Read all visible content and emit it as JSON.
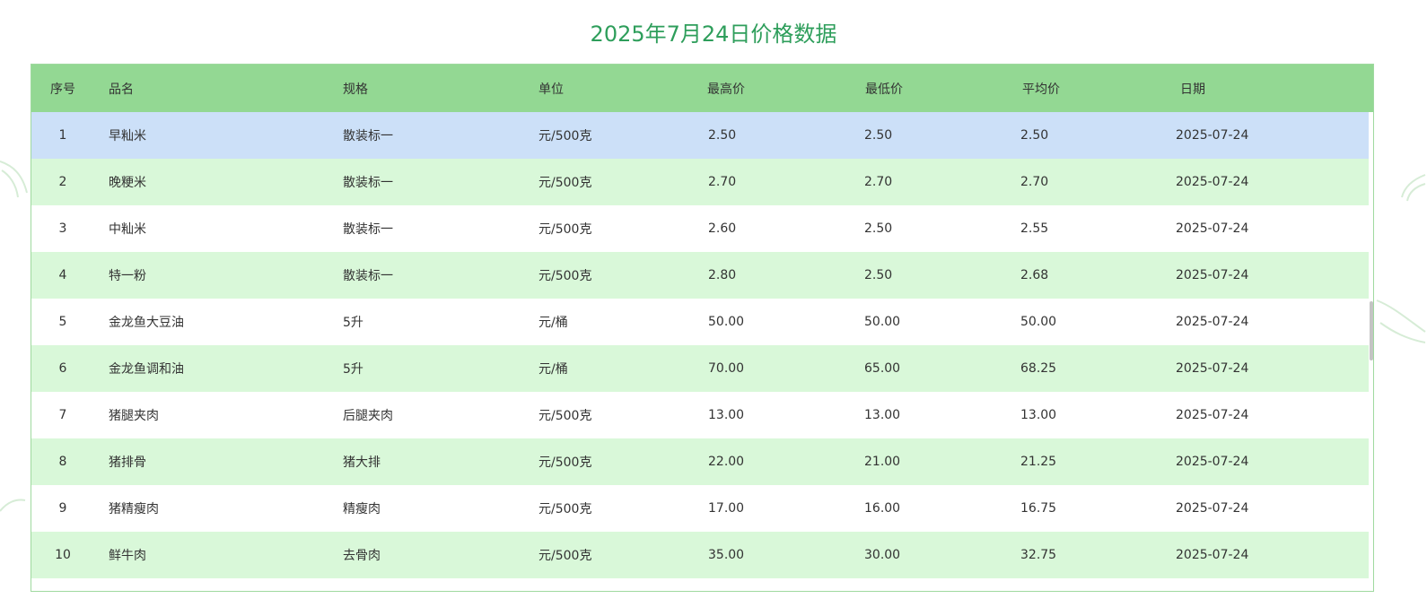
{
  "page": {
    "title": "2025年7月24日价格数据"
  },
  "table": {
    "columns": [
      "序号",
      "品名",
      "规格",
      "单位",
      "最高价",
      "最低价",
      "平均价",
      "日期"
    ],
    "rows": [
      {
        "idx": "1",
        "name": "早籼米",
        "spec": "散装标一",
        "unit": "元/500克",
        "max": "2.50",
        "min": "2.50",
        "avg": "2.50",
        "date": "2025-07-24"
      },
      {
        "idx": "2",
        "name": "晚粳米",
        "spec": "散装标一",
        "unit": "元/500克",
        "max": "2.70",
        "min": "2.70",
        "avg": "2.70",
        "date": "2025-07-24"
      },
      {
        "idx": "3",
        "name": "中籼米",
        "spec": "散装标一",
        "unit": "元/500克",
        "max": "2.60",
        "min": "2.50",
        "avg": "2.55",
        "date": "2025-07-24"
      },
      {
        "idx": "4",
        "name": "特一粉",
        "spec": "散装标一",
        "unit": "元/500克",
        "max": "2.80",
        "min": "2.50",
        "avg": "2.68",
        "date": "2025-07-24"
      },
      {
        "idx": "5",
        "name": "金龙鱼大豆油",
        "spec": "5升",
        "unit": "元/桶",
        "max": "50.00",
        "min": "50.00",
        "avg": "50.00",
        "date": "2025-07-24"
      },
      {
        "idx": "6",
        "name": "金龙鱼调和油",
        "spec": "5升",
        "unit": "元/桶",
        "max": "70.00",
        "min": "65.00",
        "avg": "68.25",
        "date": "2025-07-24"
      },
      {
        "idx": "7",
        "name": "猪腿夹肉",
        "spec": "后腿夹肉",
        "unit": "元/500克",
        "max": "13.00",
        "min": "13.00",
        "avg": "13.00",
        "date": "2025-07-24"
      },
      {
        "idx": "8",
        "name": "猪排骨",
        "spec": "猪大排",
        "unit": "元/500克",
        "max": "22.00",
        "min": "21.00",
        "avg": "21.25",
        "date": "2025-07-24"
      },
      {
        "idx": "9",
        "name": "猪精瘦肉",
        "spec": "精瘦肉",
        "unit": "元/500克",
        "max": "17.00",
        "min": "16.00",
        "avg": "16.75",
        "date": "2025-07-24"
      },
      {
        "idx": "10",
        "name": "鲜牛肉",
        "spec": "去骨肉",
        "unit": "元/500克",
        "max": "35.00",
        "min": "30.00",
        "avg": "32.75",
        "date": "2025-07-24"
      }
    ],
    "selected_row_index": 0
  },
  "scrollbar": {
    "position_fraction": 0.4
  },
  "colors": {
    "title": "#2e9e5b",
    "header_bg": "#93d893",
    "row_even_bg": "#d9f8d9",
    "row_selected_bg": "#cce0f8",
    "border": "#9fd99f",
    "decoration": "#d6ecd6"
  },
  "icons": [
    "leaf-decoration-icon"
  ]
}
